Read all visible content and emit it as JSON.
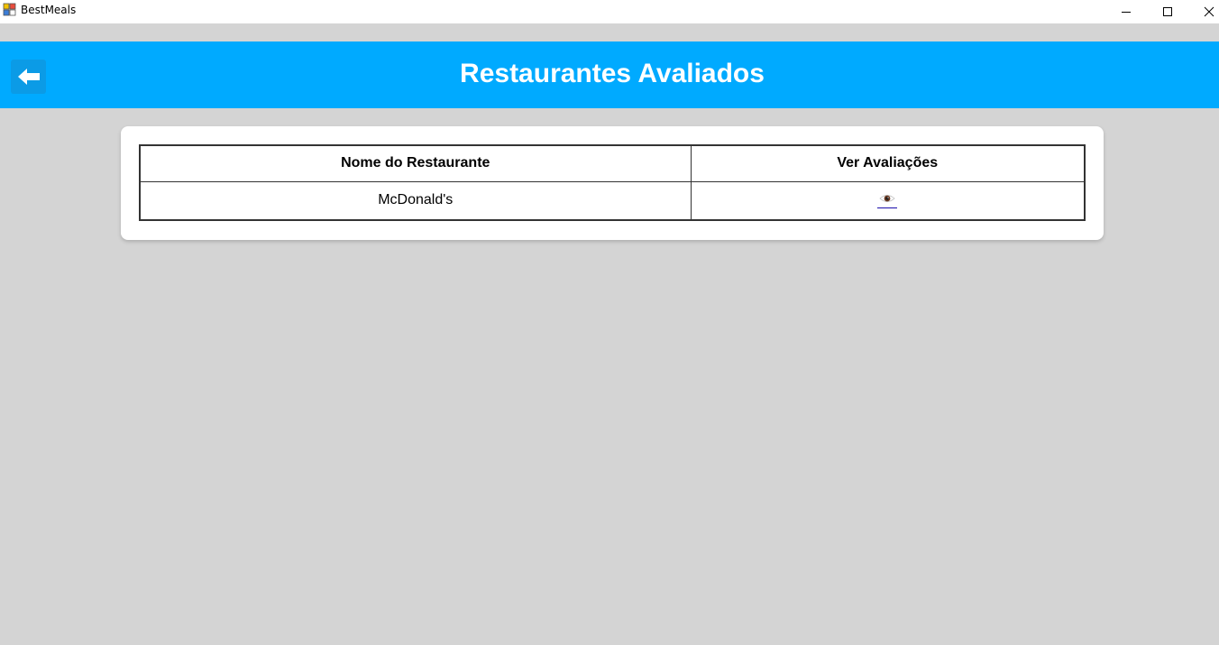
{
  "window": {
    "title": "BestMeals",
    "controls": {
      "minimize_icon": "minimize-icon",
      "maximize_icon": "maximize-icon",
      "close_icon": "close-icon"
    }
  },
  "header": {
    "title": "Restaurantes Avaliados",
    "back_icon": "arrow-left-icon",
    "color": "#00aaff"
  },
  "table": {
    "columns": [
      "Nome do Restaurante",
      "Ver Avaliações"
    ],
    "rows": [
      {
        "name": "McDonald's",
        "action_icon": "eye-icon"
      }
    ]
  }
}
